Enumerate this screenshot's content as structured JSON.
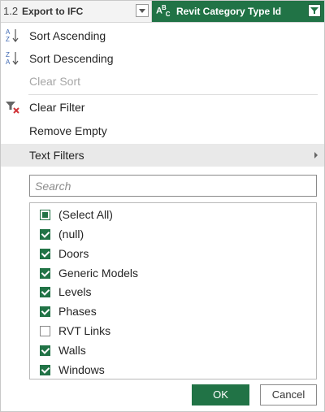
{
  "header": {
    "col1": {
      "type": "1.2",
      "name": "Export to IFC"
    },
    "col2": {
      "type": "A B C",
      "name": "Revit Category Type Id"
    }
  },
  "menu": {
    "sort_asc": "Sort Ascending",
    "sort_desc": "Sort Descending",
    "clear_sort": "Clear Sort",
    "clear_filter": "Clear Filter",
    "remove_empty": "Remove Empty",
    "text_filters": "Text Filters"
  },
  "search": {
    "placeholder": "Search",
    "value": ""
  },
  "list": {
    "items": [
      {
        "label": "(Select All)",
        "state": "partial"
      },
      {
        "label": "(null)",
        "state": "checked"
      },
      {
        "label": "Doors",
        "state": "checked"
      },
      {
        "label": "Generic Models",
        "state": "checked"
      },
      {
        "label": "Levels",
        "state": "checked"
      },
      {
        "label": "Phases",
        "state": "checked"
      },
      {
        "label": "RVT Links",
        "state": "unchecked"
      },
      {
        "label": "Walls",
        "state": "checked"
      },
      {
        "label": "Windows",
        "state": "checked"
      }
    ]
  },
  "buttons": {
    "ok": "OK",
    "cancel": "Cancel"
  },
  "colors": {
    "accent": "#217346",
    "highlight": "#e9e9e9",
    "disabled": "#a6a6a6"
  }
}
